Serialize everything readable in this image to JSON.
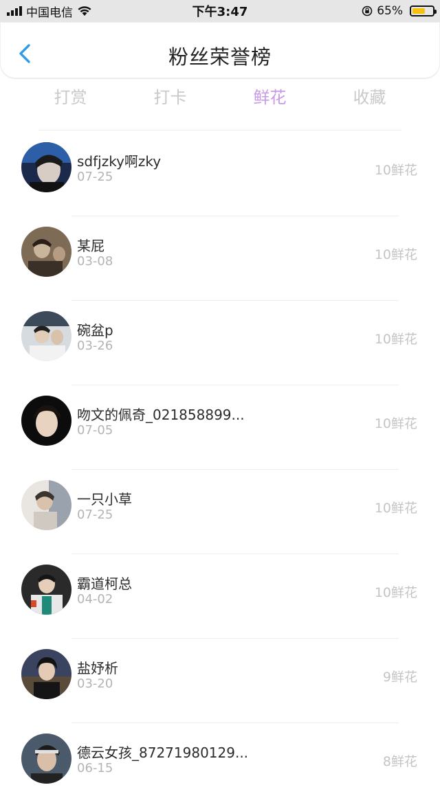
{
  "status_bar": {
    "carrier": "中国电信",
    "time": "下午3:47",
    "battery": "65%",
    "battery_level": 0.65
  },
  "header": {
    "title": "粉丝荣誉榜",
    "back_icon": "chevron-left-icon"
  },
  "tabs": [
    {
      "label": "打赏",
      "active": false
    },
    {
      "label": "打卡",
      "active": false
    },
    {
      "label": "鲜花",
      "active": true
    },
    {
      "label": "收藏",
      "active": false
    }
  ],
  "colors": {
    "accent": "#c79ae6",
    "back_arrow": "#2f9be6",
    "battery": "#f4c20d"
  },
  "list": [
    {
      "name": "sdfjzky啊zky",
      "date": "07-25",
      "amount": "10鲜花"
    },
    {
      "name": "某屁",
      "date": "03-08",
      "amount": "10鲜花"
    },
    {
      "name": "碗盆p",
      "date": "03-26",
      "amount": "10鲜花"
    },
    {
      "name": "吻文的佩奇_021858899...",
      "date": "07-05",
      "amount": "10鲜花"
    },
    {
      "name": "一只小草",
      "date": "07-25",
      "amount": "10鲜花"
    },
    {
      "name": "霸道柯总",
      "date": "04-02",
      "amount": "10鲜花"
    },
    {
      "name": "盐妤析",
      "date": "03-20",
      "amount": "9鲜花"
    },
    {
      "name": "德云女孩_87271980129...",
      "date": "06-15",
      "amount": "8鲜花"
    }
  ]
}
